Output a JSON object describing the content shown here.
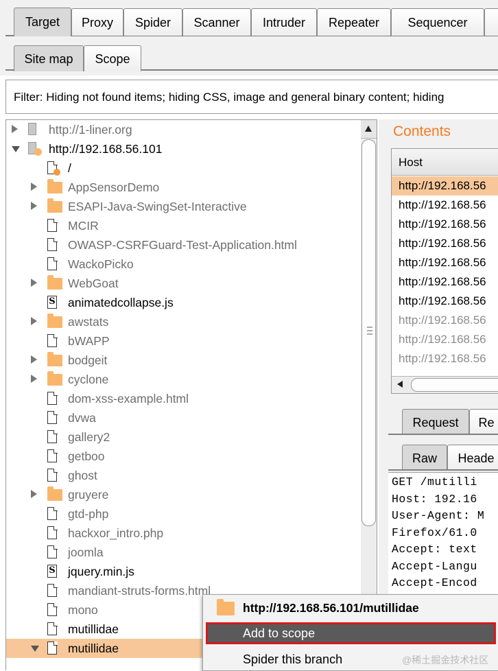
{
  "main_tabs": [
    "Target",
    "Proxy",
    "Spider",
    "Scanner",
    "Intruder",
    "Repeater",
    "Sequencer"
  ],
  "sub_tabs": [
    "Site map",
    "Scope"
  ],
  "filter_text": "Filter: Hiding not found items;  hiding CSS, image and general binary content;  hiding",
  "tree": [
    {
      "label": "http://1-liner.org",
      "icon": "host-icon",
      "expander": "right",
      "level": 0,
      "style": "grey"
    },
    {
      "label": "http://192.168.56.101",
      "icon": "host-icon",
      "expander": "down",
      "level": 0,
      "style": "black"
    },
    {
      "label": "/",
      "icon": "file-icon",
      "expander": "",
      "level": 1,
      "style": "black"
    },
    {
      "label": "AppSensorDemo",
      "icon": "folder-icon",
      "expander": "right",
      "level": 1,
      "style": "grey"
    },
    {
      "label": "ESAPI-Java-SwingSet-Interactive",
      "icon": "folder-icon",
      "expander": "right",
      "level": 1,
      "style": "grey"
    },
    {
      "label": "MCIR",
      "icon": "file-icon",
      "expander": "",
      "level": 1,
      "style": "grey"
    },
    {
      "label": "OWASP-CSRFGuard-Test-Application.html",
      "icon": "file-icon",
      "expander": "",
      "level": 1,
      "style": "grey"
    },
    {
      "label": "WackoPicko",
      "icon": "file-icon",
      "expander": "",
      "level": 1,
      "style": "grey"
    },
    {
      "label": "WebGoat",
      "icon": "folder-icon",
      "expander": "right",
      "level": 1,
      "style": "grey"
    },
    {
      "label": "animatedcollapse.js",
      "icon": "script-icon",
      "expander": "",
      "level": 1,
      "style": "black"
    },
    {
      "label": "awstats",
      "icon": "folder-icon",
      "expander": "right",
      "level": 1,
      "style": "grey"
    },
    {
      "label": "bWAPP",
      "icon": "file-icon",
      "expander": "",
      "level": 1,
      "style": "grey"
    },
    {
      "label": "bodgeit",
      "icon": "folder-icon",
      "expander": "right",
      "level": 1,
      "style": "grey"
    },
    {
      "label": "cyclone",
      "icon": "folder-icon",
      "expander": "right",
      "level": 1,
      "style": "grey"
    },
    {
      "label": "dom-xss-example.html",
      "icon": "file-icon",
      "expander": "",
      "level": 1,
      "style": "grey"
    },
    {
      "label": "dvwa",
      "icon": "file-icon",
      "expander": "",
      "level": 1,
      "style": "grey"
    },
    {
      "label": "gallery2",
      "icon": "file-icon",
      "expander": "",
      "level": 1,
      "style": "grey"
    },
    {
      "label": "getboo",
      "icon": "file-icon",
      "expander": "",
      "level": 1,
      "style": "grey"
    },
    {
      "label": "ghost",
      "icon": "file-icon",
      "expander": "",
      "level": 1,
      "style": "grey"
    },
    {
      "label": "gruyere",
      "icon": "folder-icon",
      "expander": "right",
      "level": 1,
      "style": "grey"
    },
    {
      "label": "gtd-php",
      "icon": "file-icon",
      "expander": "",
      "level": 1,
      "style": "grey"
    },
    {
      "label": "hackxor_intro.php",
      "icon": "file-icon",
      "expander": "",
      "level": 1,
      "style": "grey"
    },
    {
      "label": "joomla",
      "icon": "file-icon",
      "expander": "",
      "level": 1,
      "style": "grey"
    },
    {
      "label": "jquery.min.js",
      "icon": "script-icon",
      "expander": "",
      "level": 1,
      "style": "black"
    },
    {
      "label": "mandiant-struts-forms.html",
      "icon": "file-icon",
      "expander": "",
      "level": 1,
      "style": "grey"
    },
    {
      "label": "mono",
      "icon": "file-icon",
      "expander": "",
      "level": 1,
      "style": "grey"
    },
    {
      "label": "mutillidae",
      "icon": "file-icon",
      "expander": "",
      "level": 1,
      "style": "black"
    },
    {
      "label": "mutillidae",
      "icon": "file-icon",
      "expander": "down",
      "level": 1,
      "style": "black",
      "selected": true
    }
  ],
  "contents": {
    "title": "Contents",
    "column_host": "Host",
    "rows": [
      {
        "host": "http://192.168.56",
        "selected": true
      },
      {
        "host": "http://192.168.56"
      },
      {
        "host": "http://192.168.56"
      },
      {
        "host": "http://192.168.56"
      },
      {
        "host": "http://192.168.56"
      },
      {
        "host": "http://192.168.56"
      },
      {
        "host": "http://192.168.56"
      },
      {
        "host": "http://192.168.56",
        "dim": true
      },
      {
        "host": "http://192.168.56",
        "dim": true
      },
      {
        "host": "http://192.168.56",
        "dim": true
      }
    ]
  },
  "req_tabs": [
    "Request",
    "Re"
  ],
  "view_tabs": [
    "Raw",
    "Heade"
  ],
  "request_lines": [
    "GET /mutilli",
    "Host: 192.16",
    "User-Agent: M",
    "Firefox/61.0",
    "Accept: text",
    "Accept-Langu",
    "Accept-Encod"
  ],
  "context_menu": {
    "header": "http://192.168.56.101/mutillidae",
    "items": [
      "Add to scope",
      "Spider this branch"
    ]
  },
  "watermark": "@稀土掘金技术社区"
}
